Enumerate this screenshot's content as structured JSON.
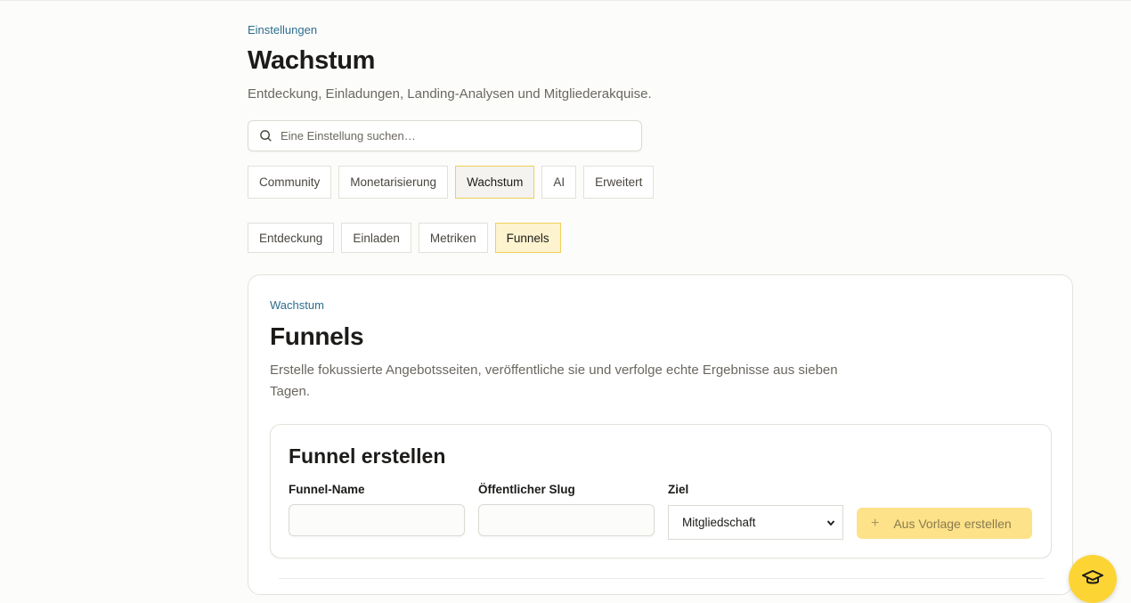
{
  "breadcrumb": "Einstellungen",
  "page": {
    "title": "Wachstum",
    "subtitle": "Entdeckung, Einladungen, Landing-Analysen und Mitgliederakquise."
  },
  "search": {
    "placeholder": "Eine Einstellung suchen…",
    "value": ""
  },
  "main_tabs": [
    {
      "label": "Community",
      "active": false
    },
    {
      "label": "Monetarisierung",
      "active": false
    },
    {
      "label": "Wachstum",
      "active": true
    },
    {
      "label": "AI",
      "active": false
    },
    {
      "label": "Erweitert",
      "active": false
    }
  ],
  "sub_tabs": [
    {
      "label": "Entdeckung",
      "active": false
    },
    {
      "label": "Einladen",
      "active": false
    },
    {
      "label": "Metriken",
      "active": false
    },
    {
      "label": "Funnels",
      "active": true
    }
  ],
  "section": {
    "breadcrumb": "Wachstum",
    "title": "Funnels",
    "description": "Erstelle fokussierte Angebotsseiten, veröffentliche sie und verfolge echte Ergebnisse aus sieben Tagen."
  },
  "create_form": {
    "title": "Funnel erstellen",
    "name_label": "Funnel-Name",
    "name_value": "",
    "slug_label": "Öffentlicher Slug",
    "slug_value": "",
    "goal_label": "Ziel",
    "goal_selected": "Mitgliedschaft",
    "button_label": "Aus Vorlage erstellen"
  },
  "colors": {
    "accent": "#fcd535",
    "active_tab_border": "#f0cf5a",
    "link": "#2d6e8e",
    "button_bg": "#fde28a"
  },
  "icons": {
    "search": "search-icon",
    "plus": "plus-icon",
    "select": "chevron-down-icon",
    "fab": "graduation-cap-icon"
  }
}
